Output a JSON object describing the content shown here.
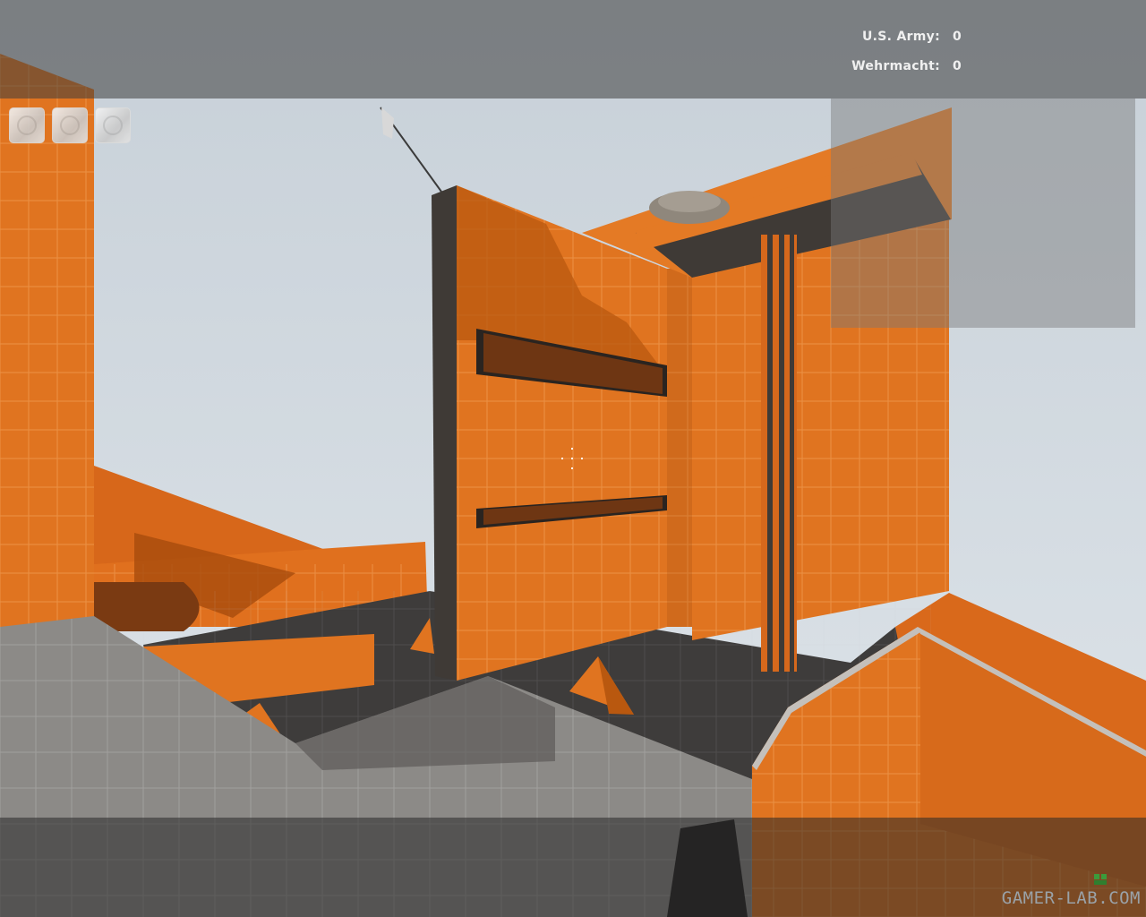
{
  "scoreboard": {
    "teams": [
      {
        "name": "U.S. Army:",
        "score": "0"
      },
      {
        "name": "Wehrmacht:",
        "score": "0"
      }
    ]
  },
  "inventory": {
    "slots": [
      "empty-slot",
      "empty-slot",
      "empty-slot"
    ]
  },
  "watermark": {
    "text": "GAMER-LAB.COM"
  },
  "colors": {
    "sky": "#b9c3cc",
    "dev_orange": "#e0701e",
    "dev_orange_dark": "#b9530f",
    "dev_gray": "#7b7a78",
    "dev_dark": "#3c3a39"
  }
}
